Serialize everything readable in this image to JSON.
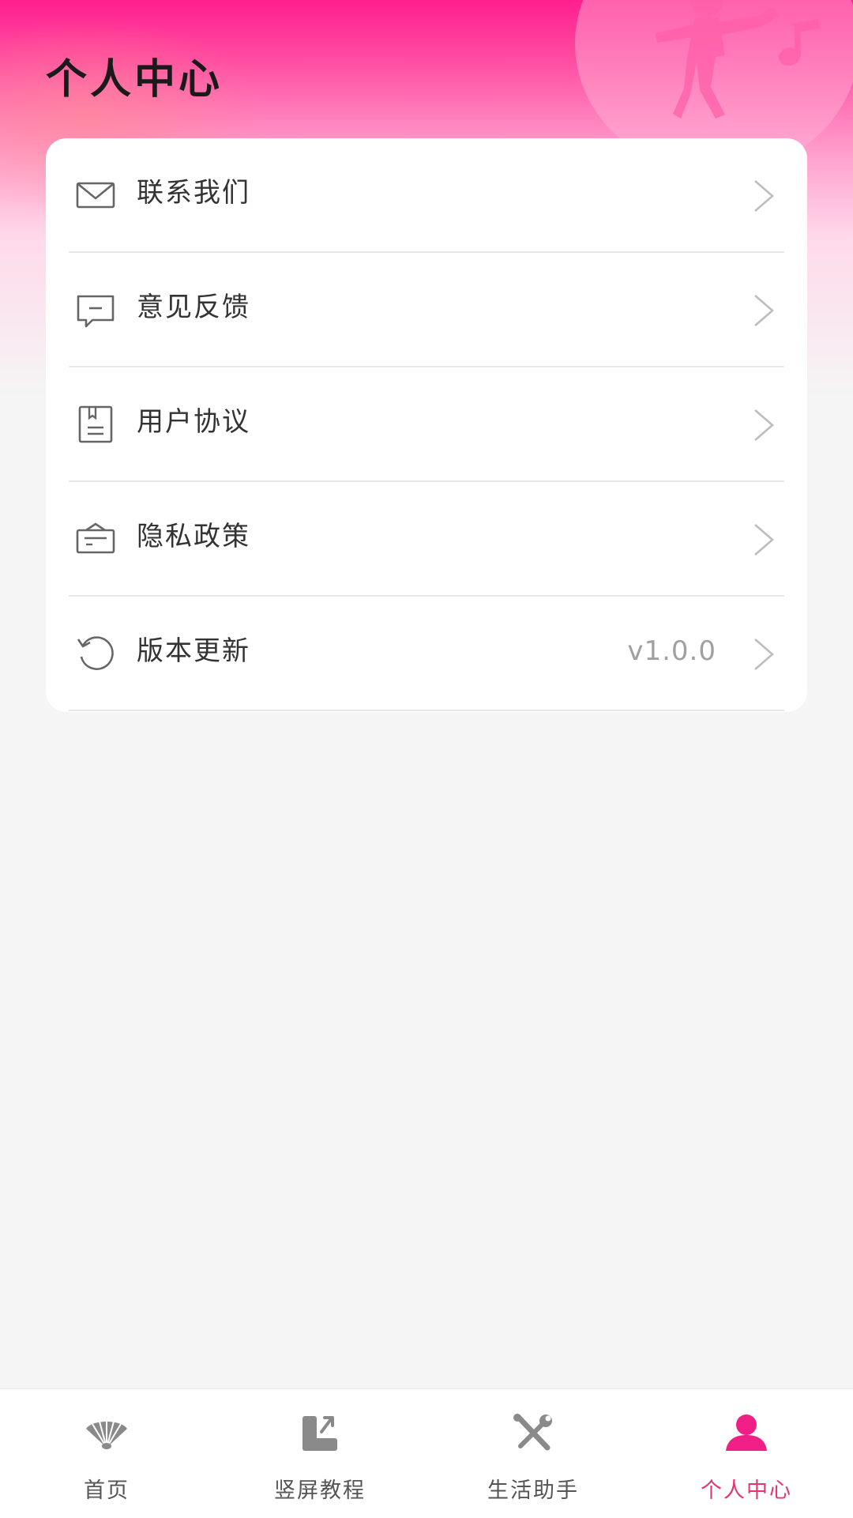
{
  "header": {
    "title": "个人中心"
  },
  "menu": {
    "items": [
      {
        "label": "联系我们",
        "icon": "mail-icon"
      },
      {
        "label": "意见反馈",
        "icon": "feedback-icon"
      },
      {
        "label": "用户协议",
        "icon": "agreement-icon"
      },
      {
        "label": "隐私政策",
        "icon": "privacy-icon"
      },
      {
        "label": "版本更新",
        "icon": "refresh-icon",
        "value": "v1.0.0"
      }
    ]
  },
  "tabbar": {
    "items": [
      {
        "label": "首页",
        "icon": "fan-icon",
        "active": false
      },
      {
        "label": "竖屏教程",
        "icon": "screen-rotate-icon",
        "active": false
      },
      {
        "label": "生活助手",
        "icon": "tools-icon",
        "active": false
      },
      {
        "label": "个人中心",
        "icon": "person-icon",
        "active": true
      }
    ]
  },
  "colors": {
    "accent": "#ff1f8e",
    "active_tab_icon": "#f01f86",
    "active_tab_label": "#e8356f",
    "inactive_tab": "#8a8a8a"
  }
}
